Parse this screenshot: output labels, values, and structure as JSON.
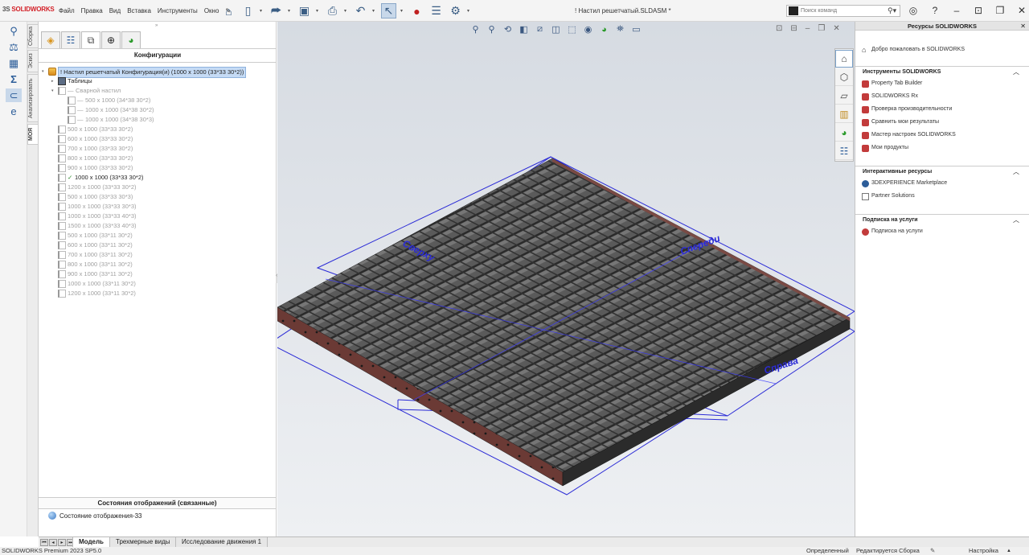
{
  "app": {
    "brand_prefix": "3S",
    "brand": "SOLIDWORKS",
    "doc_title": "! Настил решетчатый.SLDASM *"
  },
  "menu": [
    "Файл",
    "Правка",
    "Вид",
    "Вставка",
    "Инструменты",
    "Окно"
  ],
  "search": {
    "placeholder": "Поиск команд"
  },
  "fm": {
    "title": "Конфигурации",
    "root": {
      "name": "! Настил решетчатый Конфигурация(и)  (1000 x 1000 (33*33 30*2))"
    },
    "tables_label": "Таблицы",
    "weld_label": "Сварной настил",
    "weld_children": [
      "500 x 1000 (34*38 30*2)",
      "1000 x 1000 (34*38 30*2)",
      "1000 x 1000 (34*38 30*3)"
    ],
    "configs": [
      "500 x 1000 (33*33 30*2)",
      "600 x 1000 (33*33 30*2)",
      "700 x 1000 (33*33 30*2)",
      "800 x 1000 (33*33 30*2)",
      "900 x 1000 (33*33 30*2)",
      "1000 x 1000 (33*33 30*2)",
      "1200 x 1000 (33*33 30*2)",
      "500 x 1000 (33*33 30*3)",
      "1000 x 1000 (33*33 30*3)",
      "1000 x 1000 (33*33 40*3)",
      "1500 x 1000 (33*33 40*3)",
      "500 x 1000 (33*11 30*2)",
      "600 x 1000 (33*11 30*2)",
      "700 x 1000 (33*11 30*2)",
      "800 x 1000 (33*11 30*2)",
      "900 x 1000 (33*11 30*2)",
      "1000 x 1000 (33*11 30*2)",
      "1200 x 1000 (33*11 30*2)"
    ],
    "active_index": 5,
    "display_states_title": "Состояния отображений (связанные)",
    "display_state": "Состояние отображения-33"
  },
  "vtabs": [
    "Сборка",
    "Эскиз",
    "Анализировать",
    "МОЯ"
  ],
  "viewport_labels": [
    "Сверху",
    "Спереди",
    "Справа"
  ],
  "taskpane": {
    "title": "Ресурсы SOLIDWORKS",
    "welcome": "Добро пожаловать в SOLIDWORKS",
    "tools_title": "Инструменты SOLIDWORKS",
    "tools": [
      "Property Tab Builder",
      "SOLIDWORKS Rx",
      "Проверка производительности",
      "Сравнить мои результаты",
      "Мастер настроек SOLIDWORKS",
      "Мои продукты"
    ],
    "interactive_title": "Интерактивные ресурсы",
    "interactive": [
      "3DEXPERIENCE Marketplace",
      "Partner Solutions"
    ],
    "subs_title": "Подписка на услуги",
    "subs": [
      "Подписка на услуги"
    ]
  },
  "bottom_tabs": [
    "Модель",
    "Трехмерные виды",
    "Исследование движения 1"
  ],
  "status": {
    "version": "SOLIDWORKS Premium 2023 SP5.0",
    "defined": "Определенный",
    "editing": "Редактируется Сборка",
    "custom": "Настройка"
  },
  "colors": {
    "accent": "#2c5d99",
    "brand": "#d32027",
    "plane": "#2b2bd6"
  }
}
